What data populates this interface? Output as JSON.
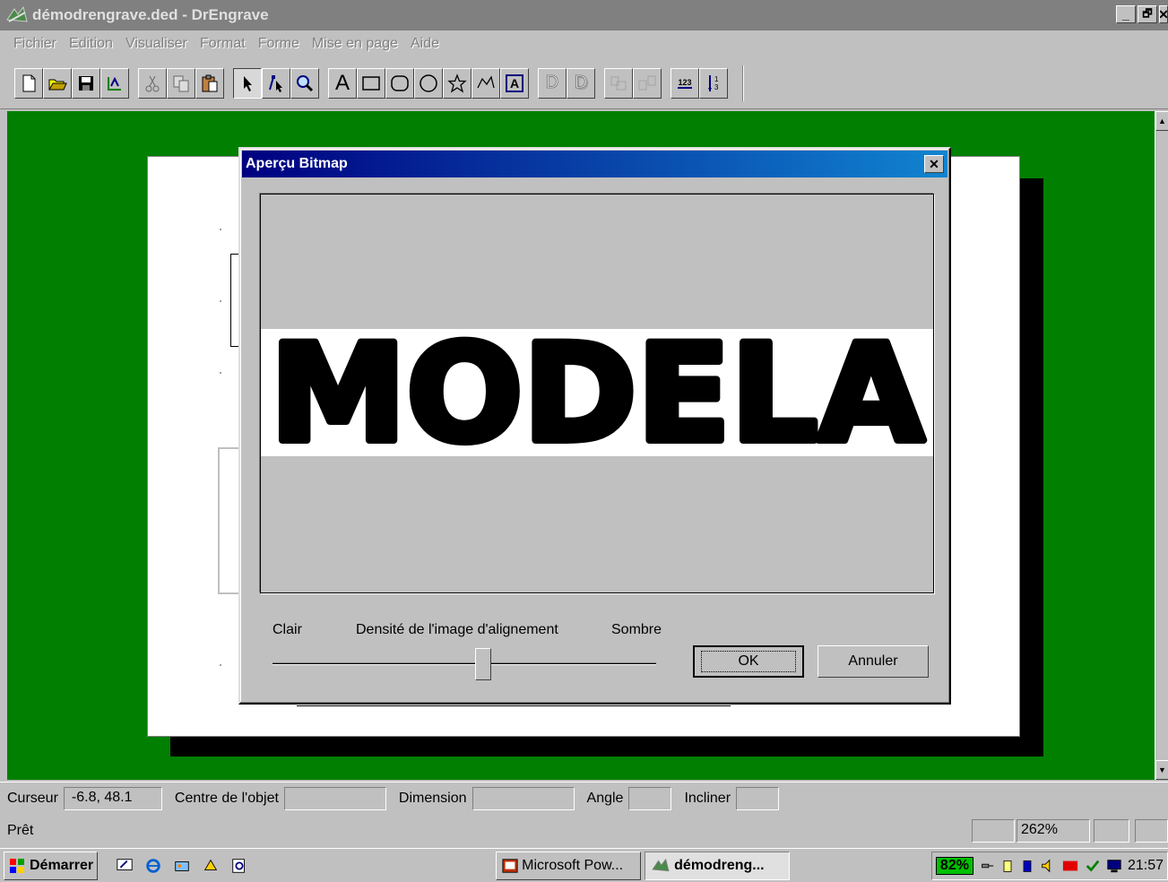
{
  "window": {
    "title": "démodrengrave.ded - DrEngrave",
    "minimize": "_",
    "maximize": "🗗",
    "close": "✕"
  },
  "menu": {
    "items": [
      "Fichier",
      "Edition",
      "Visualiser",
      "Format",
      "Forme",
      "Mise en page",
      "Aide"
    ]
  },
  "toolbar": {
    "icons": [
      "new-icon",
      "open-icon",
      "save-icon",
      "engrave-icon",
      "cut-icon",
      "copy-icon",
      "paste-icon",
      "select-arrow-icon",
      "node-edit-icon",
      "zoom-icon",
      "text-icon",
      "rectangle-icon",
      "rounded-rect-icon",
      "ellipse-icon",
      "star-icon",
      "polyline-icon",
      "framed-text-icon",
      "outline-d-icon",
      "shadow-d-icon",
      "group-icon",
      "ungroup-icon",
      "numbering-icon",
      "fraction-icon"
    ],
    "text_glyph": "A",
    "framed_glyph": "A",
    "d_glyph": "D",
    "numbering_glyph": "123"
  },
  "dialog": {
    "title": "Aperçu Bitmap",
    "close": "✕",
    "preview_text": "MODELA",
    "slider": {
      "left_label": "Clair",
      "center_label": "Densité de l'image d'alignement",
      "right_label": "Sombre",
      "position": 0.55
    },
    "ok_label": "OK",
    "cancel_label": "Annuler"
  },
  "statusbar": {
    "cursor_label": "Curseur",
    "cursor_value": "-6.8, 48.1",
    "center_label": "Centre de l'objet",
    "center_value": "",
    "dimension_label": "Dimension",
    "dimension_value": "",
    "angle_label": "Angle",
    "angle_value": "",
    "skew_label": "Incliner",
    "skew_value": "",
    "status_text": "Prêt",
    "zoom": "262%"
  },
  "taskbar": {
    "start_label": "Démarrer",
    "tasks": [
      "Microsoft Pow...",
      "démodreng..."
    ],
    "battery": "82%",
    "clock": "21:57"
  },
  "colors": {
    "workspace": "#007f00",
    "title_gradient_start": "#000080",
    "title_gradient_end": "#1084d0",
    "chrome": "#c0c0c0"
  }
}
